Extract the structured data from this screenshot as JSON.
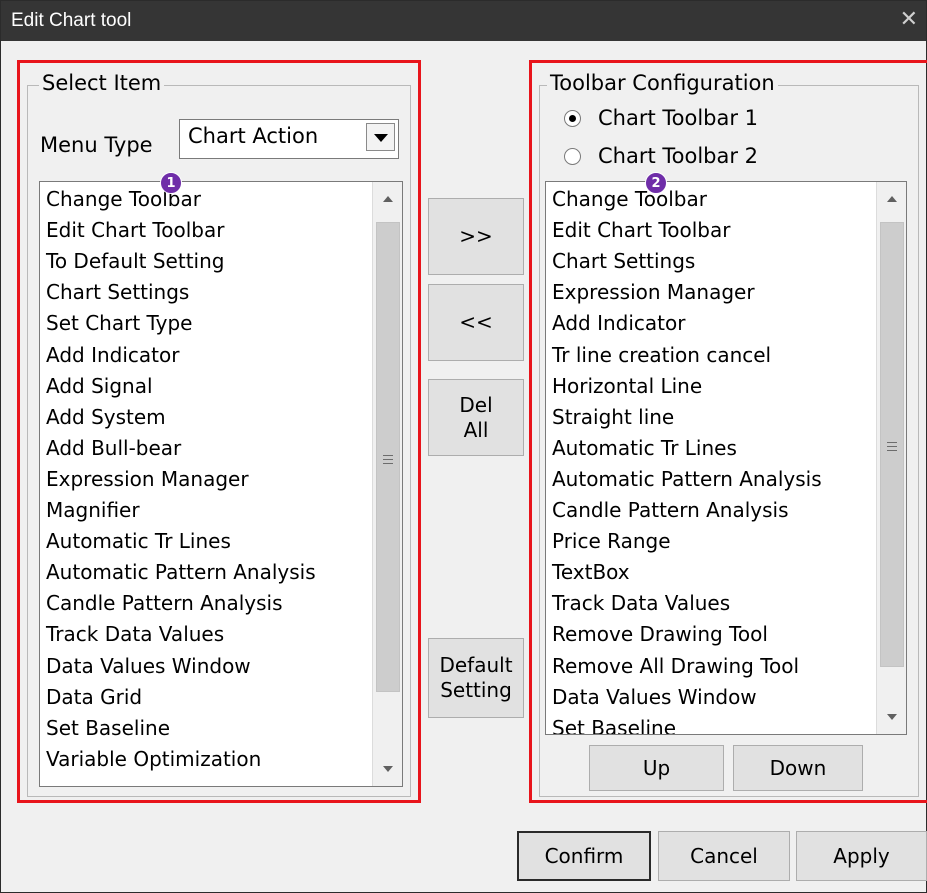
{
  "window": {
    "title": "Edit Chart tool",
    "close_glyph": "✕"
  },
  "select_item": {
    "legend": "Select Item",
    "menu_type_label": "Menu Type",
    "menu_type_value": "Chart Action",
    "badge": "1",
    "items": [
      "Change Toolbar",
      "Edit Chart Toolbar",
      "To Default Setting",
      "Chart Settings",
      "Set Chart Type",
      "Add Indicator",
      "Add Signal",
      "Add System",
      "Add Bull-bear",
      "Expression Manager",
      "Magnifier",
      "Automatic Tr Lines",
      "Automatic Pattern Analysis",
      "Candle Pattern Analysis",
      "Track Data Values",
      "Data Values Window",
      "Data Grid",
      "Set Baseline",
      "Variable Optimization"
    ]
  },
  "middle_buttons": {
    "add": ">>",
    "remove": "<<",
    "del_all_line1": "Del",
    "del_all_line2": "All",
    "default_line1": "Default",
    "default_line2": "Setting"
  },
  "toolbar_config": {
    "legend": "Toolbar Configuration",
    "radio1": "Chart Toolbar 1",
    "radio2": "Chart Toolbar 2",
    "selected_radio": 1,
    "badge": "2",
    "items": [
      "Change Toolbar",
      "Edit Chart Toolbar",
      "Chart Settings",
      "Expression Manager",
      "Add Indicator",
      "Tr line creation cancel",
      "Horizontal Line",
      "Straight line",
      "Automatic Tr Lines",
      "Automatic Pattern Analysis",
      "Candle Pattern Analysis",
      "Price Range",
      "TextBox",
      "Track Data Values",
      "Remove Drawing Tool",
      "Remove All Drawing Tool",
      "Data Values Window",
      "Set Baseline"
    ],
    "up": "Up",
    "down": "Down"
  },
  "footer": {
    "confirm": "Confirm",
    "cancel": "Cancel",
    "apply": "Apply"
  },
  "colors": {
    "highlight_red": "#e8141b",
    "badge_purple": "#6f2da8",
    "titlebar": "#353535"
  }
}
